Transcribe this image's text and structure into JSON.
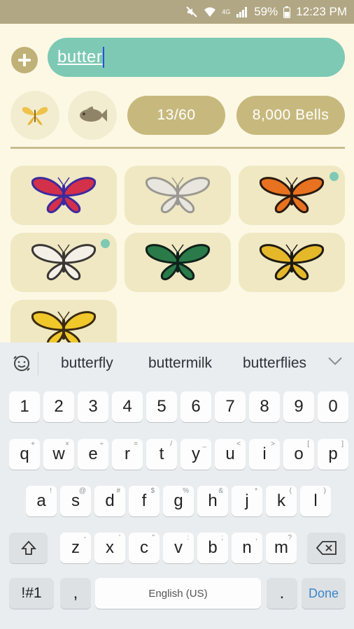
{
  "status_bar": {
    "battery": "59%",
    "time": "12:23 PM",
    "network": "4G"
  },
  "search": {
    "query": "butter"
  },
  "filters": {
    "bug_icon": "butterfly-icon",
    "fish_icon": "fish-icon",
    "count": "13/60",
    "bells": "8,000 Bells"
  },
  "results": [
    {
      "icon": "butterfly-red-icon",
      "colors": [
        "#d3304a",
        "#3a2aa0"
      ],
      "marked": false
    },
    {
      "icon": "butterfly-white-icon",
      "colors": [
        "#e8e6df",
        "#9a9890"
      ],
      "marked": false
    },
    {
      "icon": "butterfly-monarch-icon",
      "colors": [
        "#e8721f",
        "#2a1a10"
      ],
      "marked": true
    },
    {
      "icon": "butterfly-paper-kite-icon",
      "colors": [
        "#f4f0e8",
        "#3a3634"
      ],
      "marked": true
    },
    {
      "icon": "butterfly-green-icon",
      "colors": [
        "#2a7a4a",
        "#10201a"
      ],
      "marked": false
    },
    {
      "icon": "butterfly-yellow-black-icon",
      "colors": [
        "#e5b82a",
        "#1d1a14"
      ],
      "marked": false
    },
    {
      "icon": "butterfly-yellow-icon",
      "colors": [
        "#f0c82a",
        "#3a2a10"
      ],
      "marked": false
    }
  ],
  "keyboard": {
    "suggestions": [
      "butterfly",
      "buttermilk",
      "butterflies"
    ],
    "row_numbers": [
      "1",
      "2",
      "3",
      "4",
      "5",
      "6",
      "7",
      "8",
      "9",
      "0"
    ],
    "row1": [
      {
        "k": "q",
        "h": "+"
      },
      {
        "k": "w",
        "h": "×"
      },
      {
        "k": "e",
        "h": "÷"
      },
      {
        "k": "r",
        "h": "="
      },
      {
        "k": "t",
        "h": "/"
      },
      {
        "k": "y",
        "h": "_"
      },
      {
        "k": "u",
        "h": "<"
      },
      {
        "k": "i",
        "h": ">"
      },
      {
        "k": "o",
        "h": "["
      },
      {
        "k": "p",
        "h": "]"
      }
    ],
    "row2": [
      {
        "k": "a",
        "h": "!"
      },
      {
        "k": "s",
        "h": "@"
      },
      {
        "k": "d",
        "h": "#"
      },
      {
        "k": "f",
        "h": "$"
      },
      {
        "k": "g",
        "h": "%"
      },
      {
        "k": "h",
        "h": "&"
      },
      {
        "k": "j",
        "h": "*"
      },
      {
        "k": "k",
        "h": "("
      },
      {
        "k": "l",
        "h": ")"
      }
    ],
    "row3": [
      {
        "k": "z",
        "h": "-"
      },
      {
        "k": "x",
        "h": "'"
      },
      {
        "k": "c",
        "h": "\""
      },
      {
        "k": "v",
        "h": ":"
      },
      {
        "k": "b",
        "h": ";"
      },
      {
        "k": "n",
        "h": ","
      },
      {
        "k": "m",
        "h": "?"
      }
    ],
    "symbols_label": "!#1",
    "comma_label": ",",
    "space_label": "English (US)",
    "period_label": ".",
    "done_label": "Done",
    "done_color": "#3a86c8"
  }
}
